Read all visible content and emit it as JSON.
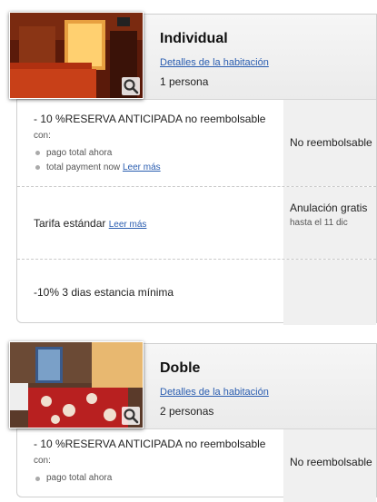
{
  "rooms": [
    {
      "title": "Individual",
      "details_link": "Detalles de la habitación",
      "occupancy": "1 persona",
      "rates": [
        {
          "name": "- 10 %RESERVA ANTICIPADA no reembolsable",
          "suffix": "con:",
          "bullets": [
            "pago total ahora",
            "total payment now"
          ],
          "more_link": "Leer más",
          "policy": "No reembolsable"
        },
        {
          "name": "Tarifa estándar",
          "more_link": "Leer más",
          "policy": "Anulación gratis",
          "policy_note": "hasta el 11 dic"
        },
        {
          "name": "-10% 3 dias estancia mínima"
        }
      ]
    },
    {
      "title": "Doble",
      "details_link": "Detalles de la habitación",
      "occupancy": "2 personas",
      "rates": [
        {
          "name": "- 10 %RESERVA ANTICIPADA no reembolsable",
          "suffix": "con:",
          "bullets": [
            "pago total ahora"
          ],
          "policy": "No reembolsable"
        }
      ]
    }
  ],
  "colors": {
    "link": "#2a5db0",
    "side_panel": "#f0f0f0",
    "header_bg": "#ebebeb"
  }
}
